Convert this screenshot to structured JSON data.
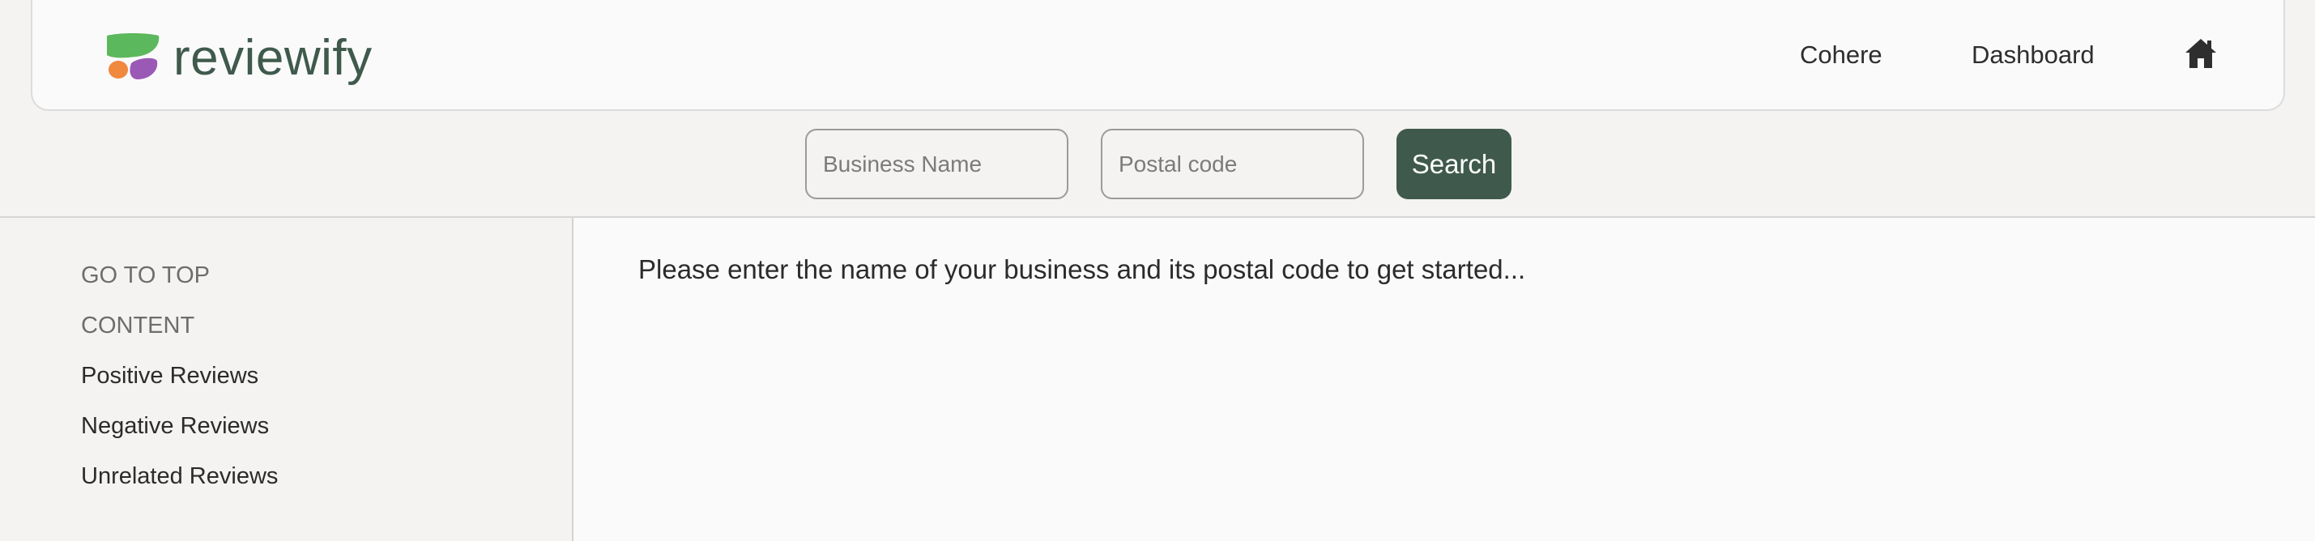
{
  "header": {
    "logo_text": "reviewify",
    "logo_icon": "reviewify-logo-icon",
    "nav": {
      "cohere_label": "Cohere",
      "dashboard_label": "Dashboard",
      "home_icon": "home-icon"
    }
  },
  "search": {
    "business_placeholder": "Business Name",
    "business_value": "",
    "postal_placeholder": "Postal code",
    "postal_value": "",
    "button_label": "Search"
  },
  "sidebar": {
    "items": [
      {
        "label": "GO TO TOP"
      },
      {
        "label": "CONTENT"
      },
      {
        "label": "Positive Reviews"
      },
      {
        "label": "Negative Reviews"
      },
      {
        "label": "Unrelated Reviews"
      }
    ]
  },
  "main": {
    "prompt": "Please enter the name of your business and its postal code to get started..."
  },
  "colors": {
    "brand_green": "#3f5a4c",
    "logo_green": "#5cb85c",
    "logo_orange": "#f0883e",
    "logo_purple": "#9b59b6",
    "page_bg": "#f4f3f1",
    "panel_bg": "#fafafa"
  }
}
